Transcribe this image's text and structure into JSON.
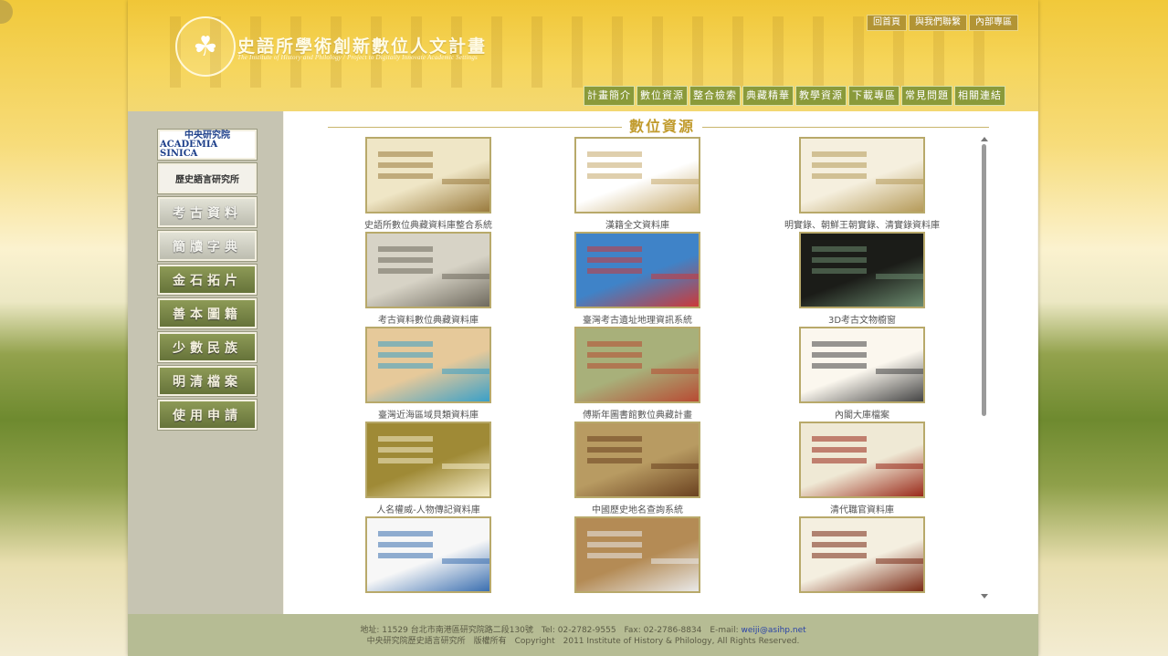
{
  "header": {
    "title": "史語所學術創新數位人文計畫",
    "subtitle": "The Institute of History and Philology / Project to Digitally Innovate Academic Settings",
    "top_links": [
      "回首頁",
      "與我們聯繫",
      "內部專區"
    ],
    "nav": [
      "計畫簡介",
      "數位資源",
      "整合檢索",
      "典藏精華",
      "教學資源",
      "下載專區",
      "常見問題",
      "相關連結"
    ]
  },
  "sidebar": {
    "sinica_cn": "中央研究院",
    "sinica_en": "ACADEMIA SINICA",
    "ihp": "歷史語言研究所",
    "items": [
      "考古資料",
      "簡牘字典",
      "金石拓片",
      "善本圖籍",
      "少數民族",
      "明清檔案",
      "使用申請"
    ]
  },
  "content": {
    "section_title": "數位資源",
    "tiles": [
      {
        "caption": "史語所數位典藏資料庫整合系統",
        "colors": [
          "#efe6c6",
          "#9a7b3e"
        ]
      },
      {
        "caption": "漢籍全文資料庫",
        "colors": [
          "#ffffff",
          "#c6a96b"
        ]
      },
      {
        "caption": "明實錄、朝鮮王朝實錄、清實錄資料庫",
        "colors": [
          "#f5efde",
          "#b59a59"
        ]
      },
      {
        "caption": "考古資料數位典藏資料庫",
        "colors": [
          "#d7d3c6",
          "#6f6a5e"
        ]
      },
      {
        "caption": "臺灣考古遺址地理資訊系統",
        "colors": [
          "#3f83c8",
          "#cc3a3a"
        ]
      },
      {
        "caption": "3D考古文物櫥窗",
        "colors": [
          "#1b1c18",
          "#6b8b6f"
        ]
      },
      {
        "caption": "臺灣近海區域貝類資料庫",
        "colors": [
          "#e6c99a",
          "#3aa0c8"
        ]
      },
      {
        "caption": "傅斯年圖書館數位典藏計畫",
        "colors": [
          "#a8b07a",
          "#b84b33"
        ]
      },
      {
        "caption": "內閣大庫檔案",
        "colors": [
          "#fbf7ee",
          "#444444"
        ]
      },
      {
        "caption": "人名權威-人物傳記資料庫",
        "colors": [
          "#9f8a36",
          "#f4ecc8"
        ]
      },
      {
        "caption": "中國歷史地名查詢系統",
        "colors": [
          "#b89b62",
          "#6b4220"
        ]
      },
      {
        "caption": "清代職官資料庫",
        "colors": [
          "#efe9d5",
          "#9a2a1a"
        ]
      },
      {
        "caption": "",
        "colors": [
          "#f7f7f7",
          "#3b6fb0"
        ]
      },
      {
        "caption": "",
        "colors": [
          "#b48b55",
          "#e9e9e9"
        ]
      },
      {
        "caption": "",
        "colors": [
          "#f4efe0",
          "#7a2a16"
        ]
      }
    ]
  },
  "footer": {
    "line1": "地址: 11529 台北市南港區研究院路二段130號　Tel: 02-2782-9555　Fax: 02-2786-8834　E-mail: ",
    "email": "weiji@asihp.net",
    "line2": "中央研究院歷史語言研究所　版權所有　Copyright　2011 Institute of History & Philology, All Rights Reserved."
  }
}
